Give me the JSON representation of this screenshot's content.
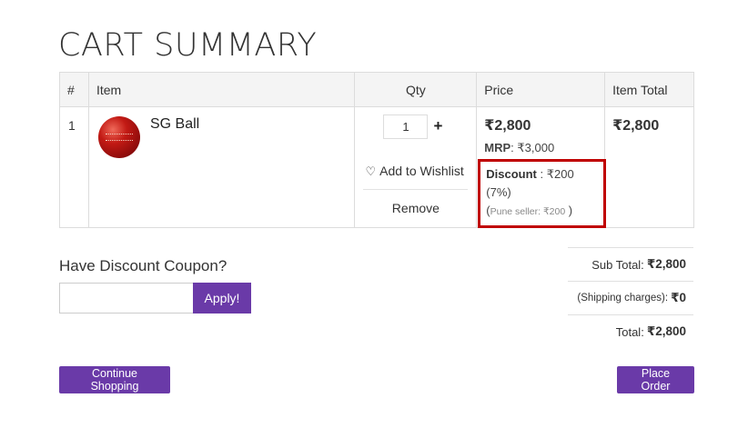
{
  "page": {
    "title": "CART SUMMARY"
  },
  "table": {
    "headers": {
      "num": "#",
      "item": "Item",
      "qty": "Qty",
      "price": "Price",
      "total": "Item Total"
    },
    "rows": [
      {
        "num": "1",
        "name": "SG Ball",
        "qty": "1",
        "plus": "+",
        "wishlist": "Add to Wishlist",
        "remove": "Remove",
        "price": "₹2,800",
        "mrp_label": "MRP",
        "mrp_value": ": ₹3,000",
        "discount_label": "Discount",
        "discount_value": " : ₹200",
        "discount_pct": "(7%)",
        "seller_open": "(",
        "seller_text": "Pune seller: ₹200",
        "seller_close": " )",
        "item_total": "₹2,800"
      }
    ]
  },
  "coupon": {
    "title": "Have Discount Coupon?",
    "input_value": "",
    "apply_label": "Apply!"
  },
  "summary": {
    "subtotal_label": "Sub Total:",
    "subtotal_value": "₹2,800",
    "shipping_label": "(Shipping charges):",
    "shipping_value": "₹0",
    "total_label": "Total:",
    "total_value": "₹2,800"
  },
  "buttons": {
    "continue": "Continue Shopping",
    "place_order": "Place Order"
  },
  "colors": {
    "accent": "#6a3aa8",
    "highlight_border": "#c00000"
  }
}
